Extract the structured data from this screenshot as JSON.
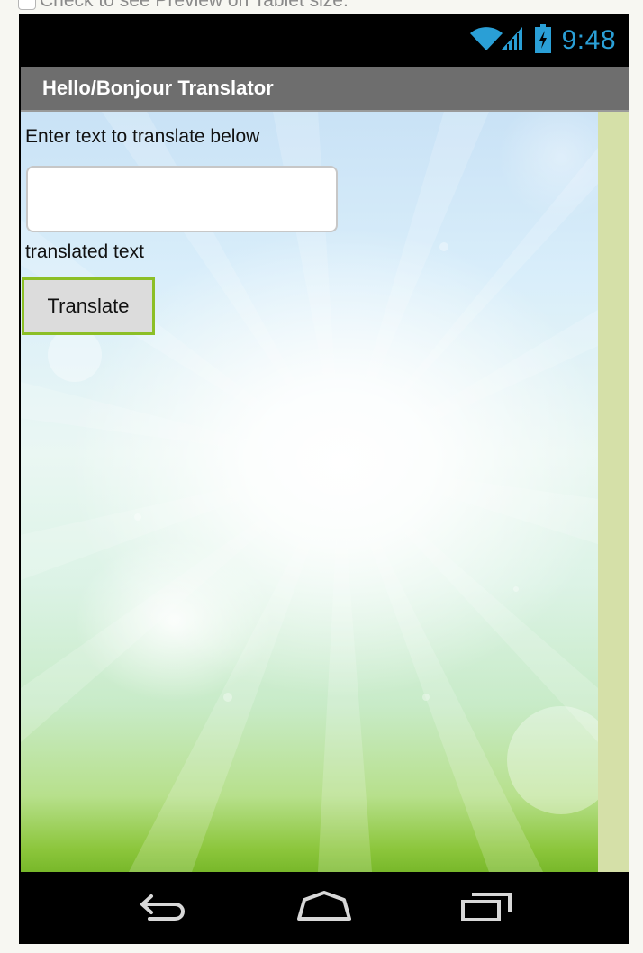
{
  "tablet_preview": {
    "label": "Check to see Preview on Tablet size.",
    "checked": false
  },
  "status_bar": {
    "time": "9:48",
    "icons": [
      "wifi-icon",
      "signal-icon",
      "battery-charging-icon"
    ],
    "accent_color": "#2a9fd6"
  },
  "app": {
    "title": "Hello/Bonjour Translator",
    "title_bar_color": "#6e6e6e"
  },
  "form": {
    "prompt_label": "Enter text to translate below",
    "input_value": "",
    "output_label": "translated text",
    "translate_button": "Translate",
    "button_border_color": "#8cbf26"
  },
  "nav_bar": {
    "buttons": [
      "back-icon",
      "home-icon",
      "recent-apps-icon"
    ]
  }
}
